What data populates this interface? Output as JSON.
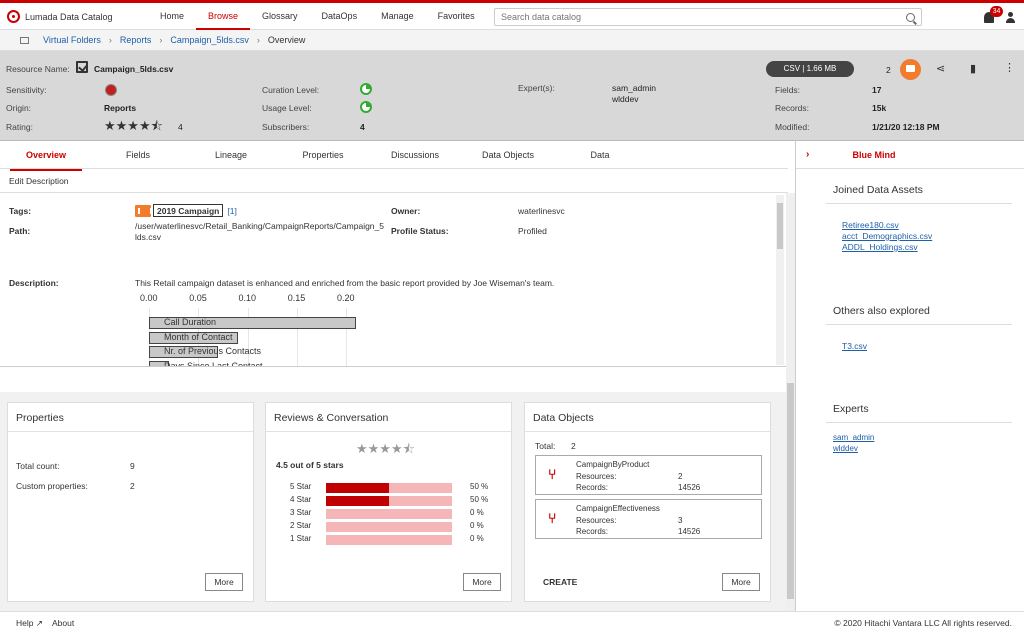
{
  "app": {
    "title": "Lumada Data Catalog",
    "notification_count": "34"
  },
  "nav": [
    "Home",
    "Browse",
    "Glossary",
    "DataOps",
    "Manage",
    "Favorites"
  ],
  "search": {
    "placeholder": "Search data catalog"
  },
  "breadcrumbs": [
    "Virtual Folders",
    "Reports",
    "Campaign_5lds.csv",
    "Overview"
  ],
  "resource": {
    "name_label": "Resource Name:",
    "name": "Campaign_5lds.csv",
    "sensitivity_label": "Sensitivity:",
    "origin_label": "Origin:",
    "origin": "Reports",
    "rating_label": "Rating:",
    "rating_stars": "★★★★⯪",
    "rating": "4",
    "curation_label": "Curation Level:",
    "usage_label": "Usage Level:",
    "subscribers_label": "Subscribers:",
    "subscribers": "4",
    "experts_label": "Expert(s):",
    "experts": [
      "sam_admin",
      "wlddev"
    ],
    "format": "CSV | 1.66 MB",
    "comments": "2",
    "fields_label": "Fields:",
    "fields": "17",
    "records_label": "Records:",
    "records": "15k",
    "modified_label": "Modified:",
    "modified": "1/21/20 12:18 PM"
  },
  "tabs": [
    "Overview",
    "Fields",
    "Lineage",
    "Properties",
    "Discussions",
    "Data Objects",
    "Data"
  ],
  "right_tab": "Blue Mind",
  "edit_description": "Edit Description",
  "details": {
    "tags_label": "Tags:",
    "tag": "2019 Campaign",
    "tag_more": "[1]",
    "path_label": "Path:",
    "path": "/user/waterlinesvc/Retail_Banking/CampaignReports/Campaign_5",
    "path2": "lds.csv",
    "owner_label": "Owner:",
    "owner": "waterlinesvc",
    "profile_label": "Profile Status:",
    "profile": "Profiled",
    "description_label": "Description:",
    "description": "This Retail campaign dataset is enhanced and enriched from the basic report provided by Joe Wiseman's team."
  },
  "chart_data": {
    "type": "bar",
    "orientation": "horizontal",
    "ticks": [
      "0.00",
      "0.05",
      "0.10",
      "0.15",
      "0.20"
    ],
    "xlim": [
      0,
      0.2
    ],
    "categories": [
      "Call Duration",
      "Month of Contact",
      "Nr. of Previous Contacts",
      "Days Since Last Contact"
    ],
    "values": [
      0.21,
      0.09,
      0.07,
      0.02
    ]
  },
  "properties": {
    "title": "Properties",
    "total_label": "Total count:",
    "total": "9",
    "custom_label": "Custom properties:",
    "custom": "2",
    "more": "More"
  },
  "reviews": {
    "title": "Reviews & Conversation",
    "stars": "★★★★⯪",
    "summary": "4.5 out of 5 stars",
    "rows": [
      {
        "label": "5 Star",
        "pct": "50 %",
        "value": 0.5
      },
      {
        "label": "4 Star",
        "pct": "50 %",
        "value": 0.5
      },
      {
        "label": "3 Star",
        "pct": "0 %",
        "value": 0
      },
      {
        "label": "2 Star",
        "pct": "0 %",
        "value": 0
      },
      {
        "label": "1 Star",
        "pct": "0 %",
        "value": 0
      }
    ],
    "more": "More"
  },
  "data_objects": {
    "title": "Data Objects",
    "total_label": "Total:",
    "total": "2",
    "items": [
      {
        "name": "CampaignByProduct",
        "resources_label": "Resources:",
        "resources": "2",
        "records_label": "Records:",
        "records": "14526"
      },
      {
        "name": "CampaignEffectiveness",
        "resources_label": "Resources:",
        "resources": "3",
        "records_label": "Records:",
        "records": "14526"
      }
    ],
    "create": "CREATE",
    "more": "More"
  },
  "right_panel": {
    "joined_title": "Joined Data Assets",
    "joined": [
      "Retiree180.csv",
      "acct_Demographics.csv",
      "ADDL_Holdings.csv"
    ],
    "others_title": "Others also explored",
    "others": [
      "T3.csv"
    ],
    "experts_title": "Experts",
    "experts": [
      "sam_admin",
      "wlddev"
    ]
  },
  "footer": {
    "help": "Help",
    "about": "About",
    "copyright": "© 2020 Hitachi Vantara LLC All rights reserved."
  },
  "colors": {
    "accent": "#cc0000",
    "link": "#1e5fa8",
    "orange": "#f37b2c"
  }
}
